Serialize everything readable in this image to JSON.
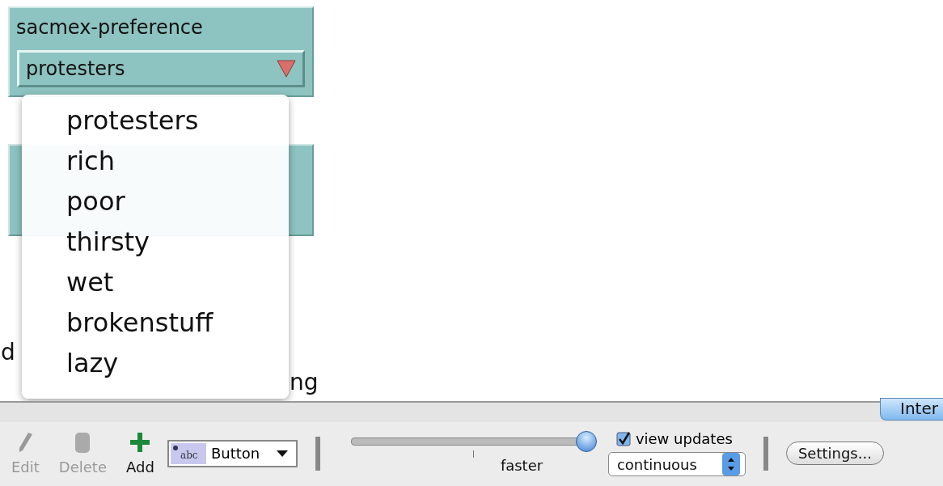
{
  "chooser": {
    "label": "sacmex-preference",
    "value": "protesters"
  },
  "menu": {
    "items": [
      "protesters",
      "rich",
      "poor",
      "thirsty",
      "wet",
      "brokenstuff",
      "lazy"
    ]
  },
  "note_fragments": [
    "d",
    "ng"
  ],
  "tab": {
    "label": "Inter"
  },
  "toolbar": {
    "tools": [
      {
        "kind": "edit",
        "label": "Edit",
        "disabled": true
      },
      {
        "kind": "delete",
        "label": "Delete",
        "disabled": true
      },
      {
        "kind": "add",
        "label": "Add",
        "disabled": false
      }
    ],
    "widget_icon_text": "abc",
    "widget_type": "Button",
    "speed": {
      "label": "faster",
      "level": 1.0
    },
    "view_updates": {
      "label": "view updates",
      "checked": true
    },
    "update_mode": "continuous",
    "settings": "Settings..."
  }
}
